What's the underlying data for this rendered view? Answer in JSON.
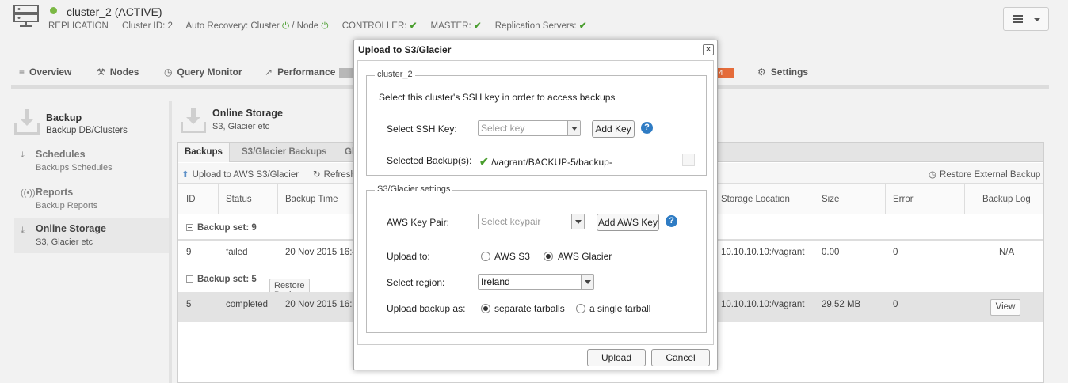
{
  "cluster": {
    "title": "cluster_2 (ACTIVE)",
    "type": "REPLICATION",
    "cluster_id": "Cluster ID: 2",
    "auto_recovery": "Auto Recovery: Cluster",
    "node_text": "/ Node",
    "controller": "CONTROLLER:",
    "master": "MASTER:",
    "replication_servers": "Replication Servers:",
    "status_color": "#7bb844"
  },
  "nav": {
    "items": [
      {
        "label": "Overview",
        "icon": "list-icon"
      },
      {
        "label": "Nodes",
        "icon": "nodes-icon"
      },
      {
        "label": "Query Monitor",
        "icon": "clock-icon"
      },
      {
        "label": "Performance",
        "icon": "chart-icon"
      },
      {
        "label": "Settings",
        "icon": "gear-icon"
      }
    ],
    "badge_count": "4"
  },
  "sidebar": {
    "header_title": "Backup",
    "header_sub": "Backup DB/Clusters",
    "items": [
      {
        "label": "Schedules",
        "sub": "Backups Schedules"
      },
      {
        "label": "Reports",
        "sub": "Backup Reports"
      },
      {
        "label": "Online Storage",
        "sub": "S3, Glacier etc"
      }
    ]
  },
  "main": {
    "title": "Online Storage",
    "subtitle": "S3, Glacier etc",
    "tabs": [
      "Backups",
      "S3/Glacier Backups",
      "Gl"
    ],
    "upload_label": "Upload to AWS S3/Glacier",
    "refresh_label": "Refresh",
    "restore_external": "Restore External Backup",
    "columns": [
      "ID",
      "Status",
      "Backup Time",
      "Storage Location",
      "Size",
      "Error",
      "Backup Log"
    ],
    "groups": [
      {
        "label": "Backup set: 9"
      },
      {
        "label": "Backup set: 5",
        "button": "Restore Backup"
      }
    ],
    "rows": [
      {
        "id": "9",
        "status": "failed",
        "time": "20 Nov 2015 16:4",
        "location": "10.10.10.10:/vagrant",
        "size": "0.00",
        "error": "0",
        "log": "N/A"
      },
      {
        "id": "5",
        "status": "completed",
        "time": "20 Nov 2015 16:3",
        "location": "10.10.10.10:/vagrant",
        "size": "29.52 MB",
        "error": "0",
        "log": "View"
      }
    ]
  },
  "dialog": {
    "title": "Upload to S3/Glacier",
    "fieldset1_legend": "cluster_2",
    "instruction": "Select this cluster's SSH key in order to access backups",
    "ssh_label": "Select SSH Key:",
    "ssh_placeholder": "Select key",
    "add_key": "Add Key",
    "selected_label": "Selected Backup(s):",
    "selected_value": "/vagrant/BACKUP-5/backup-",
    "fieldset2_legend": "S3/Glacier settings",
    "aws_key_label": "AWS Key Pair:",
    "aws_key_placeholder": "Select keypair",
    "add_aws_key": "Add AWS Key",
    "upload_to_label": "Upload to:",
    "upload_opt1": "AWS S3",
    "upload_opt2": "AWS Glacier",
    "region_label": "Select region:",
    "region_value": "Ireland",
    "upload_as_label": "Upload backup as:",
    "as_opt1": "separate tarballs",
    "as_opt2": "a single tarball",
    "upload_btn": "Upload",
    "cancel_btn": "Cancel",
    "help": "?"
  }
}
